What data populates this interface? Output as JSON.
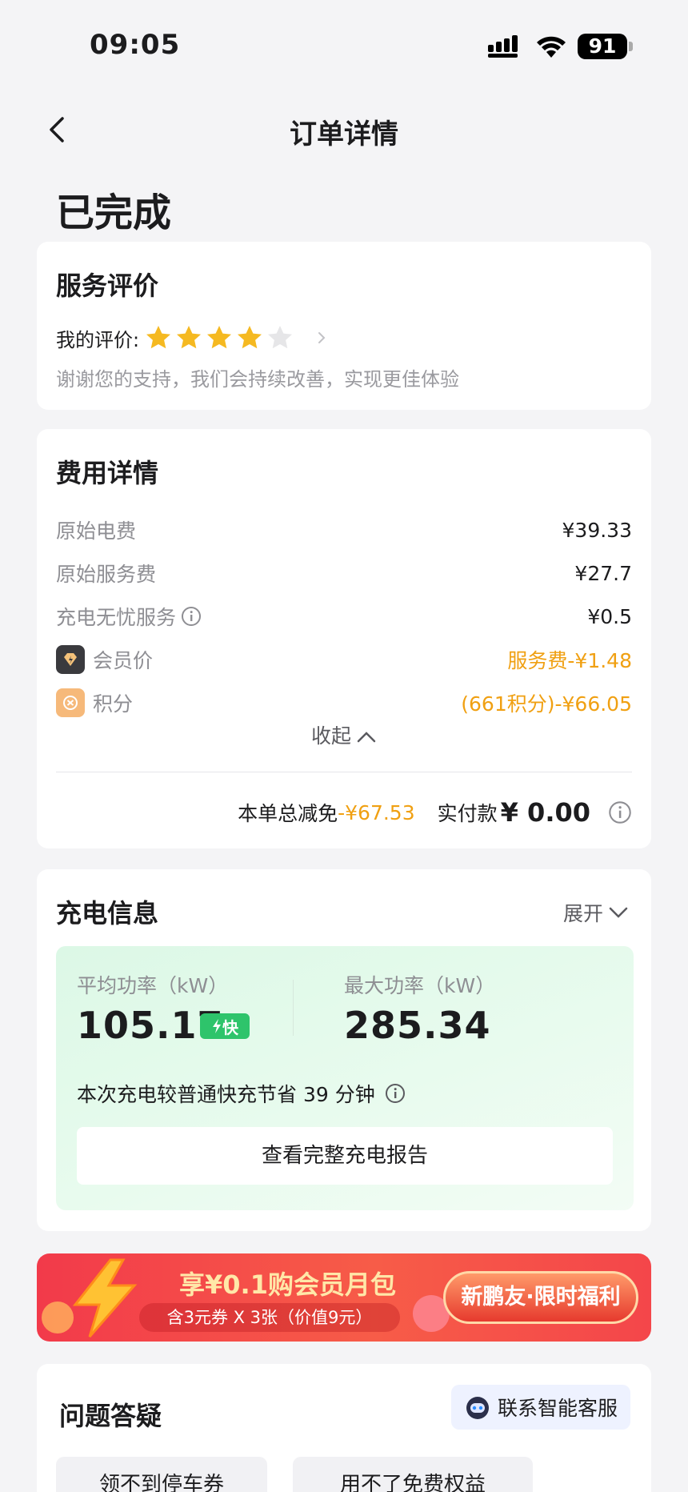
{
  "status_bar": {
    "time": "09:05",
    "battery": "91"
  },
  "nav": {
    "title": "订单详情"
  },
  "order": {
    "status": "已完成"
  },
  "rating": {
    "title": "服务评价",
    "label": "我的评价:",
    "stars_filled": 4,
    "stars_total": 5,
    "thanks": "谢谢您的支持，我们会持续改善，实现更佳体验"
  },
  "fees": {
    "title": "费用详情",
    "items": [
      {
        "label": "原始电费",
        "value": "¥39.33"
      },
      {
        "label": "原始服务费",
        "value": "¥27.7"
      },
      {
        "label": "充电无忧服务",
        "value": "¥0.5"
      },
      {
        "label": "会员价",
        "value": "服务费-¥1.48"
      },
      {
        "label": "积分",
        "value": "(661积分)-¥66.05"
      }
    ],
    "collapse_label": "收起",
    "total_discount_label": "本单总减免",
    "total_discount": "-¥67.53",
    "paid_label": "实付款",
    "paid_amount": "¥ 0.00"
  },
  "charge": {
    "title": "充电信息",
    "expand_label": "展开",
    "avg_power_label": "平均功率（kW）",
    "avg_power": "105.17",
    "fast_badge": "快",
    "max_power_label": "最大功率（kW）",
    "max_power": "285.34",
    "saving_text": "本次充电较普通快充节省 39 分钟",
    "report_button": "查看完整充电报告"
  },
  "promo": {
    "headline": "享¥0.1购会员月包",
    "sub": "含3元券 X 3张（价值9元）",
    "pill": "新鹏友·限时福利"
  },
  "faq": {
    "title": "问题答疑",
    "support_button": "联系智能客服",
    "chips": [
      "领不到停车券",
      "用不了免费权益"
    ]
  },
  "colors": {
    "accent_orange": "#f0a012",
    "star_gold": "#f5b921",
    "star_empty": "#e6e6e8",
    "fast_green": "#2ec46b",
    "promo_red": "#f23a4a"
  }
}
